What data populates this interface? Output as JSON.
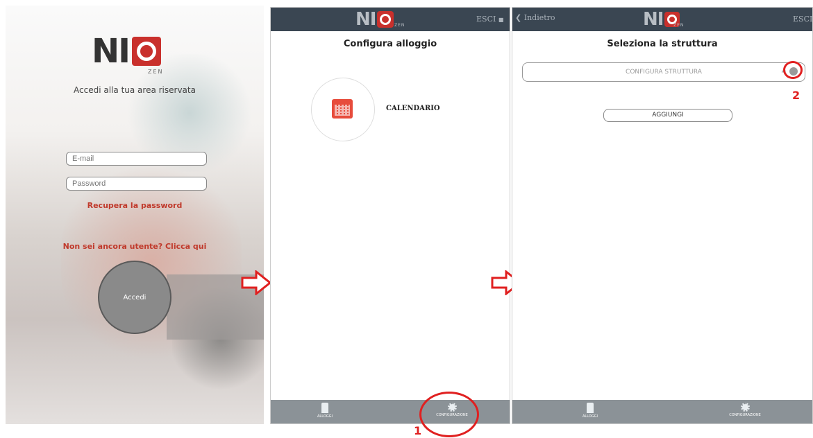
{
  "login": {
    "logo_text": "NI",
    "logo_sub": "ZEN",
    "subtitle": "Accedi alla tua area riservata",
    "email_placeholder": "E-mail",
    "password_placeholder": "Password",
    "recover_link": "Recupera la password",
    "register_link": "Non sei ancora utente? Clicca qui",
    "login_button": "Accedi"
  },
  "configura": {
    "logo_text": "NI",
    "logo_sub": "ZEN",
    "logout_label": "ESCI",
    "title": "Configura alloggio",
    "calendar_label": "CALENDARIO",
    "tabs": [
      {
        "label": "ALLOGGI",
        "icon": "door-icon"
      },
      {
        "label": "CONFIGURAZIONE",
        "icon": "gear-icon"
      }
    ],
    "annotation_number": "1"
  },
  "struttura": {
    "back_label": "Indietro",
    "logo_text": "NI",
    "logo_sub": "ZEN",
    "logout_label": "ESCI",
    "title": "Seleziona la struttura",
    "select_placeholder": "CONFIGURA STRUTTURA",
    "add_button": "AGGIUNGI",
    "tabs": [
      {
        "label": "ALLOGGI",
        "icon": "door-icon"
      },
      {
        "label": "CONFIGURAZIONE",
        "icon": "gear-icon"
      }
    ],
    "annotation_number": "2"
  },
  "colors": {
    "brand_red": "#c9302c",
    "topbar": "#3a4652",
    "tabbar": "#8b9297",
    "annotation_red": "#e02020"
  }
}
